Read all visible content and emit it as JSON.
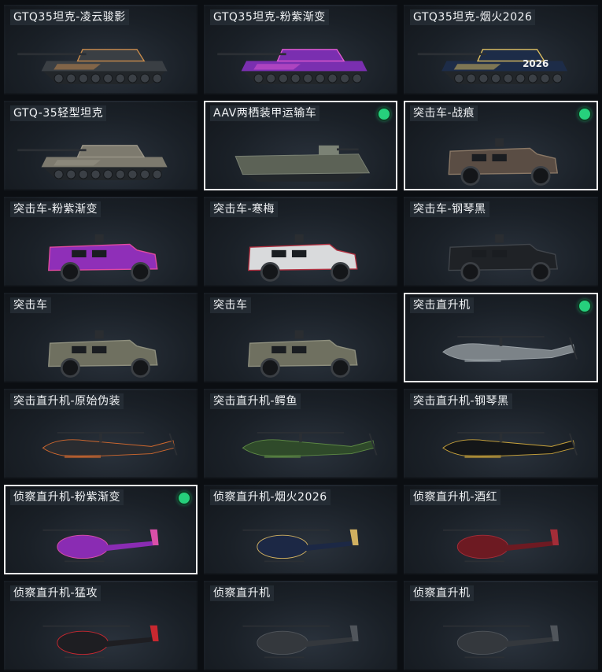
{
  "tiles": [
    {
      "label": "GTQ35坦克-凌云骏影",
      "kind": "tank",
      "selected": false,
      "color": "#3a3f44",
      "accent": "#c98b4b"
    },
    {
      "label": "GTQ35坦克-粉紫渐变",
      "kind": "tank",
      "selected": false,
      "color": "#7a2fb0",
      "accent": "#e05ad0"
    },
    {
      "label": "GTQ35坦克-烟火2026",
      "kind": "tank",
      "selected": false,
      "color": "#1d2c48",
      "accent": "#e0c060",
      "badge": "2026"
    },
    {
      "label": "GTQ-35轻型坦克",
      "kind": "tank",
      "selected": false,
      "color": "#7d7a6e",
      "accent": "#9a9588"
    },
    {
      "label": "AAV两栖装甲运输车",
      "kind": "apc",
      "selected": true,
      "color": "#5c6256",
      "accent": "#7b8275"
    },
    {
      "label": "突击车-战痕",
      "kind": "truck",
      "selected": true,
      "color": "#5a4d44",
      "accent": "#8a7866"
    },
    {
      "label": "突击车-粉紫渐变",
      "kind": "truck",
      "selected": false,
      "color": "#8f2fb8",
      "accent": "#e04aa0"
    },
    {
      "label": "突击车-寒梅",
      "kind": "truck",
      "selected": false,
      "color": "#d9dadc",
      "accent": "#b03040"
    },
    {
      "label": "突击车-钢琴黑",
      "kind": "truck",
      "selected": false,
      "color": "#1f2226",
      "accent": "#40454b"
    },
    {
      "label": "突击车",
      "kind": "truck",
      "selected": false,
      "color": "#6f7060",
      "accent": "#8e8f7e"
    },
    {
      "label": "突击车",
      "kind": "truck",
      "selected": false,
      "color": "#6f7060",
      "accent": "#8e8f7e"
    },
    {
      "label": "突击直升机",
      "kind": "attack_heli",
      "selected": true,
      "color": "#7c8388",
      "accent": "#9aa1a6"
    },
    {
      "label": "突击直升机-原始伪装",
      "kind": "attack_heli",
      "selected": false,
      "color": "#2a2c30",
      "accent": "#d2692e"
    },
    {
      "label": "突击直升机-鳄鱼",
      "kind": "attack_heli",
      "selected": false,
      "color": "#2f4a2a",
      "accent": "#5e8a45"
    },
    {
      "label": "突击直升机-钢琴黑",
      "kind": "attack_heli",
      "selected": false,
      "color": "#141618",
      "accent": "#c9a33b"
    },
    {
      "label": "侦察直升机-粉紫渐变",
      "kind": "scout_heli",
      "selected": true,
      "color": "#8a2cb3",
      "accent": "#d94fa8"
    },
    {
      "label": "侦察直升机-烟火2026",
      "kind": "scout_heli",
      "selected": false,
      "color": "#1c2845",
      "accent": "#d0b060"
    },
    {
      "label": "侦察直升机-酒红",
      "kind": "scout_heli",
      "selected": false,
      "color": "#6d1a22",
      "accent": "#a32d38"
    },
    {
      "label": "侦察直升机-猛攻",
      "kind": "scout_heli",
      "selected": false,
      "color": "#1e1e22",
      "accent": "#c82830"
    },
    {
      "label": "侦察直升机",
      "kind": "scout_heli",
      "selected": false,
      "color": "#34383d",
      "accent": "#50555b"
    },
    {
      "label": "侦察直升机",
      "kind": "scout_heli",
      "selected": false,
      "color": "#34383d",
      "accent": "#50555b"
    }
  ]
}
